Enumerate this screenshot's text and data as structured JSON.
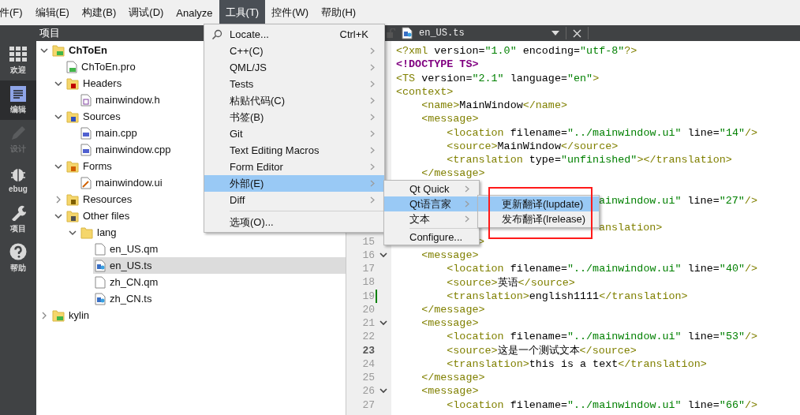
{
  "menubar": [
    {
      "label": "件(F)",
      "selected": false
    },
    {
      "label": "编辑(E)",
      "selected": false
    },
    {
      "label": "构建(B)",
      "selected": false
    },
    {
      "label": "调试(D)",
      "selected": false
    },
    {
      "label": "Analyze",
      "selected": false
    },
    {
      "label": "工具(T)",
      "selected": true
    },
    {
      "label": "控件(W)",
      "selected": false
    },
    {
      "label": "帮助(H)",
      "selected": false
    }
  ],
  "modebar": [
    {
      "label": "欢迎",
      "kind": "welcome",
      "selected": false,
      "disabled": false
    },
    {
      "label": "编辑",
      "kind": "edit",
      "selected": true,
      "disabled": false
    },
    {
      "label": "设计",
      "kind": "design",
      "selected": false,
      "disabled": true
    },
    {
      "label": "ebug",
      "kind": "debug",
      "selected": false,
      "disabled": false
    },
    {
      "label": "项目",
      "kind": "projects",
      "selected": false,
      "disabled": false
    },
    {
      "label": "帮助",
      "kind": "help",
      "selected": false,
      "disabled": false
    }
  ],
  "project_panel": {
    "title": "项目"
  },
  "tree": {
    "items": [
      {
        "label": "ChToEn",
        "kind": "project",
        "bold": true,
        "expanded": true,
        "selected": false,
        "children": [
          {
            "label": "ChToEn.pro",
            "kind": "pro",
            "selected": false
          },
          {
            "label": "Headers",
            "kind": "folder-h",
            "expanded": true,
            "selected": false,
            "children": [
              {
                "label": "mainwindow.h",
                "kind": "file-h",
                "selected": false
              }
            ]
          },
          {
            "label": "Sources",
            "kind": "folder-cpp",
            "expanded": true,
            "selected": false,
            "children": [
              {
                "label": "main.cpp",
                "kind": "file-cpp",
                "selected": false
              },
              {
                "label": "mainwindow.cpp",
                "kind": "file-cpp",
                "selected": false
              }
            ]
          },
          {
            "label": "Forms",
            "kind": "folder-ui",
            "expanded": true,
            "selected": false,
            "children": [
              {
                "label": "mainwindow.ui",
                "kind": "file-ui",
                "selected": false
              }
            ]
          },
          {
            "label": "Resources",
            "kind": "folder-res",
            "expanded": false,
            "selected": false
          },
          {
            "label": "Other files",
            "kind": "folder-other",
            "expanded": true,
            "selected": false,
            "children": [
              {
                "label": "lang",
                "kind": "folder",
                "expanded": true,
                "selected": false,
                "children": [
                  {
                    "label": "en_US.qm",
                    "kind": "file",
                    "selected": false
                  },
                  {
                    "label": "en_US.ts",
                    "kind": "file-ts",
                    "selected": true
                  },
                  {
                    "label": "zh_CN.qm",
                    "kind": "file",
                    "selected": false
                  },
                  {
                    "label": "zh_CN.ts",
                    "kind": "file-ts",
                    "selected": false
                  }
                ]
              }
            ]
          }
        ]
      },
      {
        "label": "kylin",
        "kind": "project",
        "bold": false,
        "expanded": false,
        "selected": false
      }
    ]
  },
  "editor": {
    "tab": {
      "filename": "en_US.ts"
    },
    "lines": [
      {
        "kind": "full",
        "segments": [
          {
            "kind": "tag",
            "text": "<?xml"
          },
          {
            "kind": "plain",
            "text": " version="
          },
          {
            "kind": "str",
            "text": "\"1.0\""
          },
          {
            "kind": "plain",
            "text": " encoding="
          },
          {
            "kind": "str",
            "text": "\"utf-8\""
          },
          {
            "kind": "tag",
            "text": "?>"
          }
        ]
      },
      {
        "kind": "full",
        "segments": [
          {
            "kind": "doctype",
            "text": "<!DOCTYPE TS>"
          }
        ]
      },
      {
        "kind": "full",
        "segments": [
          {
            "kind": "tag",
            "text": "<TS"
          },
          {
            "kind": "plain",
            "text": " version="
          },
          {
            "kind": "str",
            "text": "\"2.1\""
          },
          {
            "kind": "plain",
            "text": " language="
          },
          {
            "kind": "str",
            "text": "\"en\""
          },
          {
            "kind": "tag",
            "text": ">"
          }
        ]
      },
      {
        "kind": "full",
        "segments": [
          {
            "kind": "tag",
            "text": "<context>"
          }
        ]
      },
      {
        "kind": "full",
        "segments": [
          {
            "kind": "tag",
            "text": "    <name>"
          },
          {
            "kind": "plain",
            "text": "MainWindow"
          },
          {
            "kind": "tag",
            "text": "</name>"
          }
        ]
      },
      {
        "kind": "full",
        "segments": [
          {
            "kind": "tag",
            "text": "    <message>"
          }
        ]
      },
      {
        "kind": "full",
        "segments": [
          {
            "kind": "tag",
            "text": "        <location"
          },
          {
            "kind": "plain",
            "text": " filename="
          },
          {
            "kind": "str",
            "text": "\"../mainwindow.ui\""
          },
          {
            "kind": "plain",
            "text": " line="
          },
          {
            "kind": "str",
            "text": "\"14\""
          },
          {
            "kind": "tag",
            "text": "/>"
          }
        ]
      },
      {
        "kind": "full",
        "segments": [
          {
            "kind": "tag",
            "text": "        <source>"
          },
          {
            "kind": "plain",
            "text": "MainWindow"
          },
          {
            "kind": "tag",
            "text": "</source>"
          }
        ]
      },
      {
        "kind": "full",
        "segments": [
          {
            "kind": "tag",
            "text": "        <translation"
          },
          {
            "kind": "plain",
            "text": " type="
          },
          {
            "kind": "str",
            "text": "\"unfinished\""
          },
          {
            "kind": "tag",
            "text": "></translation>"
          }
        ]
      },
      {
        "kind": "full",
        "segments": [
          {
            "kind": "tag",
            "text": "    </message>"
          }
        ]
      },
      {
        "kind": "hidden"
      },
      {
        "kind": "behind-linguist-menu",
        "segments": [
          {
            "kind": "str",
            "text": "ainwindow.ui\""
          },
          {
            "kind": "plain",
            "text": " line="
          },
          {
            "kind": "str",
            "text": "\"27\""
          },
          {
            "kind": "tag",
            "text": "/>"
          }
        ]
      },
      {
        "kind": "hidden"
      },
      {
        "kind": "behind-linguist-menu",
        "segments": [
          {
            "kind": "tag",
            "text": "anslation>"
          }
        ]
      },
      {
        "kind": "behind-external-menu",
        "number": "15",
        "segments": [
          {
            "kind": "tag",
            "text": ">"
          }
        ]
      },
      {
        "kind": "full",
        "number": "16",
        "fold": true,
        "segments": [
          {
            "kind": "tag",
            "text": "    <message>"
          }
        ]
      },
      {
        "kind": "full",
        "number": "17",
        "segments": [
          {
            "kind": "tag",
            "text": "        <location"
          },
          {
            "kind": "plain",
            "text": " filename="
          },
          {
            "kind": "str",
            "text": "\"../mainwindow.ui\""
          },
          {
            "kind": "plain",
            "text": " line="
          },
          {
            "kind": "str",
            "text": "\"40\""
          },
          {
            "kind": "tag",
            "text": "/>"
          }
        ]
      },
      {
        "kind": "full",
        "number": "18",
        "segments": [
          {
            "kind": "tag",
            "text": "        <source>"
          },
          {
            "kind": "plain",
            "text": "英语"
          },
          {
            "kind": "tag",
            "text": "</source>"
          }
        ]
      },
      {
        "kind": "full",
        "number": "19",
        "changed": true,
        "segments": [
          {
            "kind": "tag",
            "text": "        <translation>"
          },
          {
            "kind": "plain",
            "text": "english1111"
          },
          {
            "kind": "tag",
            "text": "</translation>"
          }
        ]
      },
      {
        "kind": "full",
        "number": "20",
        "segments": [
          {
            "kind": "tag",
            "text": "    </message>"
          }
        ]
      },
      {
        "kind": "full",
        "number": "21",
        "fold": true,
        "segments": [
          {
            "kind": "tag",
            "text": "    <message>"
          }
        ]
      },
      {
        "kind": "full",
        "number": "22",
        "segments": [
          {
            "kind": "tag",
            "text": "        <location"
          },
          {
            "kind": "plain",
            "text": " filename="
          },
          {
            "kind": "str",
            "text": "\"../mainwindow.ui\""
          },
          {
            "kind": "plain",
            "text": " line="
          },
          {
            "kind": "str",
            "text": "\"53\""
          },
          {
            "kind": "tag",
            "text": "/>"
          }
        ]
      },
      {
        "kind": "full",
        "number": "23",
        "current": true,
        "segments": [
          {
            "kind": "tag",
            "text": "        <source>"
          },
          {
            "kind": "plain",
            "text": "这是一个测试文本"
          },
          {
            "kind": "tag",
            "text": "</source>"
          }
        ]
      },
      {
        "kind": "full",
        "number": "24",
        "segments": [
          {
            "kind": "tag",
            "text": "        <translation>"
          },
          {
            "kind": "plain",
            "text": "this is a text"
          },
          {
            "kind": "tag",
            "text": "</translation>"
          }
        ]
      },
      {
        "kind": "full",
        "number": "25",
        "segments": [
          {
            "kind": "tag",
            "text": "    </message>"
          }
        ]
      },
      {
        "kind": "full",
        "number": "26",
        "fold": true,
        "segments": [
          {
            "kind": "tag",
            "text": "    <message>"
          }
        ]
      },
      {
        "kind": "full",
        "number": "27",
        "segments": [
          {
            "kind": "tag",
            "text": "        <location"
          },
          {
            "kind": "plain",
            "text": " filename="
          },
          {
            "kind": "str",
            "text": "\"../mainwindow.ui\""
          },
          {
            "kind": "plain",
            "text": " line="
          },
          {
            "kind": "str",
            "text": "\"66\""
          },
          {
            "kind": "tag",
            "text": "/>"
          }
        ]
      }
    ]
  },
  "tools_menu": {
    "items": [
      {
        "kind": "item",
        "label": "Locate...",
        "shortcut": "Ctrl+K",
        "submenu": false,
        "selected": false
      },
      {
        "kind": "item",
        "label": "C++(C)",
        "submenu": true,
        "selected": false
      },
      {
        "kind": "item",
        "label": "QML/JS",
        "submenu": true,
        "selected": false
      },
      {
        "kind": "item",
        "label": "Tests",
        "submenu": true,
        "selected": false
      },
      {
        "kind": "item",
        "label": "粘贴代码(C)",
        "submenu": true,
        "selected": false
      },
      {
        "kind": "item",
        "label": "书签(B)",
        "submenu": true,
        "selected": false
      },
      {
        "kind": "item",
        "label": "Git",
        "submenu": true,
        "selected": false
      },
      {
        "kind": "item",
        "label": "Text Editing Macros",
        "submenu": true,
        "selected": false
      },
      {
        "kind": "item",
        "label": "Form Editor",
        "submenu": true,
        "selected": false
      },
      {
        "kind": "item",
        "label": "外部(E)",
        "submenu": true,
        "selected": true
      },
      {
        "kind": "item",
        "label": "Diff",
        "submenu": true,
        "selected": false
      },
      {
        "kind": "separator"
      },
      {
        "kind": "item",
        "label": "选项(O)...",
        "submenu": false,
        "selected": false
      }
    ]
  },
  "external_menu": {
    "items": [
      {
        "kind": "item",
        "label": "Qt Quick",
        "submenu": true,
        "selected": false
      },
      {
        "kind": "item",
        "label": "Qt语言家",
        "submenu": true,
        "selected": true
      },
      {
        "kind": "item",
        "label": "文本",
        "submenu": true,
        "selected": false
      },
      {
        "kind": "separator"
      },
      {
        "kind": "item",
        "label": "Configure...",
        "submenu": false,
        "selected": false
      }
    ]
  },
  "linguist_menu": {
    "highlighted": true,
    "items": [
      {
        "kind": "item",
        "label": "更新翻译(lupdate)",
        "submenu": false,
        "selected": true
      },
      {
        "kind": "item",
        "label": "发布翻译(lrelease)",
        "submenu": false,
        "selected": false
      }
    ]
  }
}
